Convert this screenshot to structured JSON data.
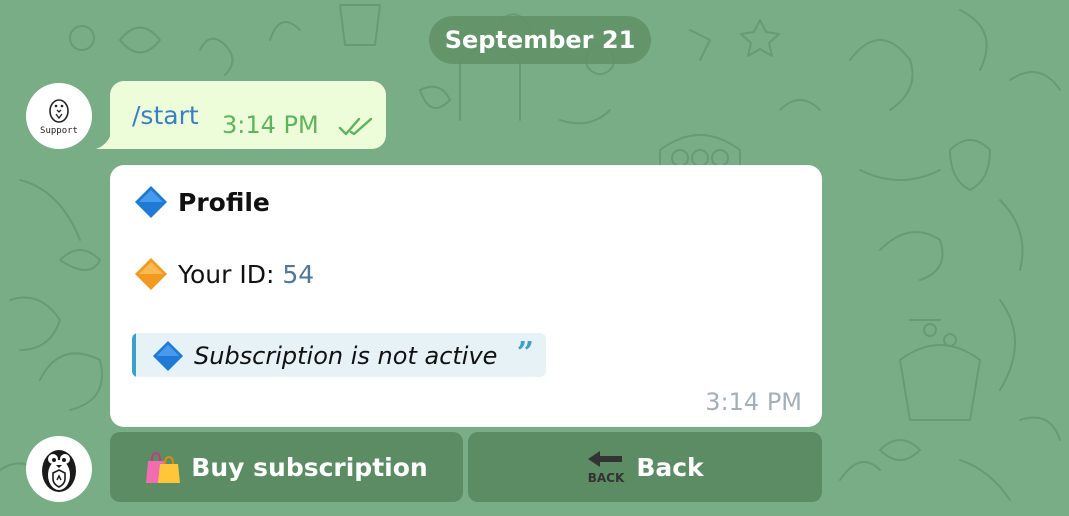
{
  "chat": {
    "date": "September 21"
  },
  "bot": {
    "avatar_label": "Support"
  },
  "outgoing": {
    "text": "/start",
    "time": "3:14 PM"
  },
  "card": {
    "title": "Profile",
    "id_label": "Your ID:",
    "id_value": "54",
    "quote_text": "Subscription is not active",
    "time": "3:14 PM"
  },
  "keyboard": {
    "buy_label": "Buy subscription",
    "back_label": "Back",
    "back_icon_text": "BACK"
  },
  "colors": {
    "background": "#79ad86",
    "outgoing_bubble": "#eefdd9",
    "link": "#3a7fc4",
    "check": "#5fb35b",
    "quote_accent": "#3aa1c8"
  },
  "icons": {
    "title": "blue-diamond-icon",
    "id": "orange-diamond-icon",
    "quote": "blue-diamond-icon",
    "read_status": "double-check-icon",
    "buy": "shopping-bags-icon",
    "back": "back-arrow-icon"
  }
}
